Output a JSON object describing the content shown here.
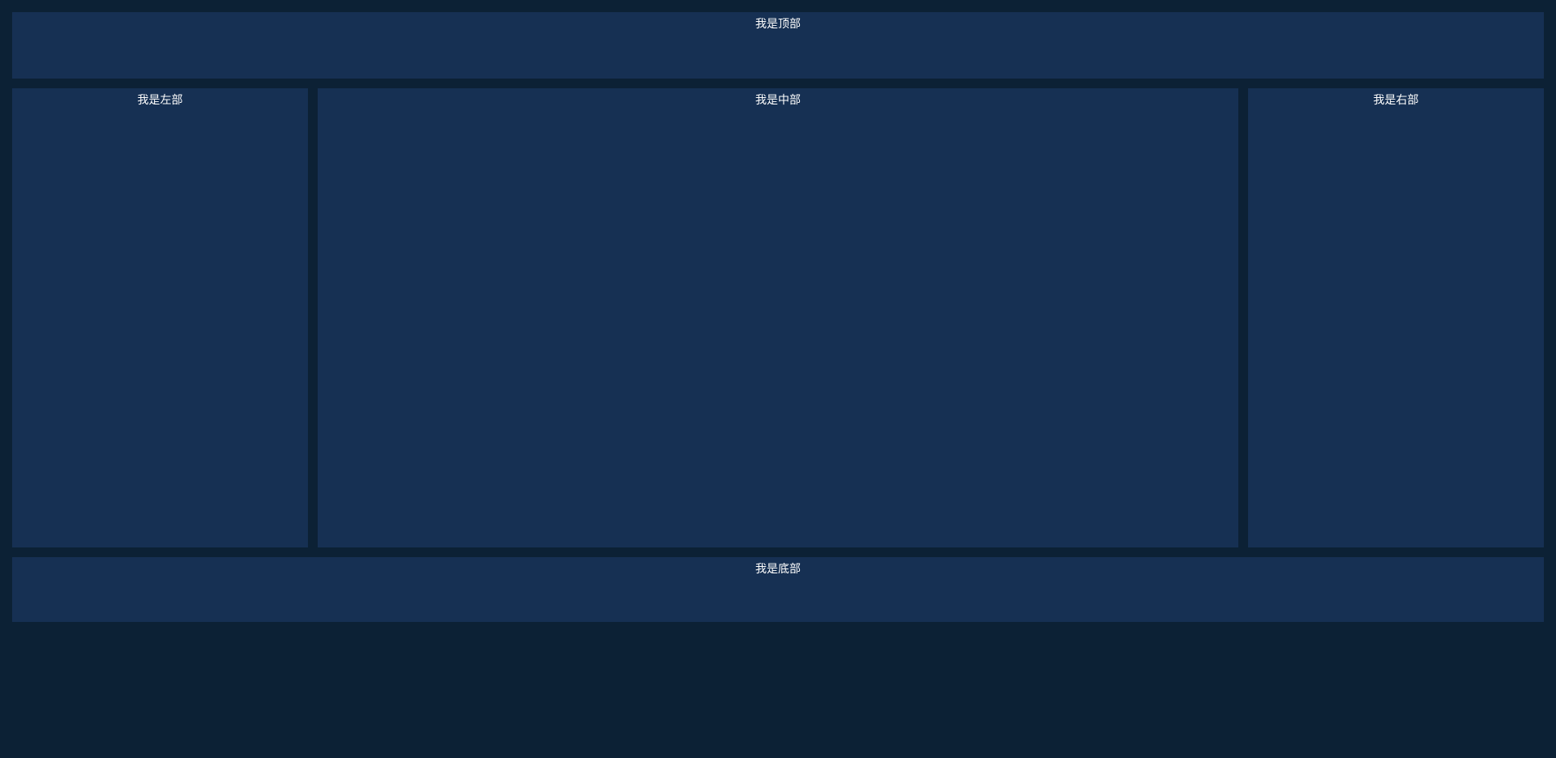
{
  "layout": {
    "top": {
      "label": "我是顶部"
    },
    "left": {
      "label": "我是左部"
    },
    "center": {
      "label": "我是中部"
    },
    "right": {
      "label": "我是右部"
    },
    "bottom": {
      "label": "我是底部"
    }
  }
}
